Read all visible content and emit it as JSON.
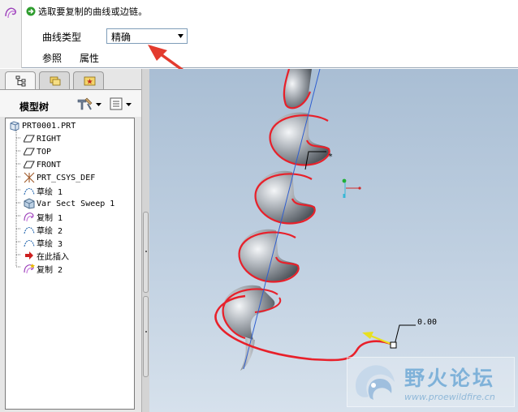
{
  "dashboard": {
    "prompt": "选取要复制的曲线或边链。",
    "curve_type_label": "曲线类型",
    "curve_type_value": "精确",
    "tabs": [
      "参照",
      "属性"
    ]
  },
  "navigator": {
    "tree_title": "模型树",
    "items": [
      {
        "label": "PRT0001.PRT",
        "icon": "part-icon"
      },
      {
        "label": "RIGHT",
        "icon": "datum-plane-icon"
      },
      {
        "label": "TOP",
        "icon": "datum-plane-icon"
      },
      {
        "label": "FRONT",
        "icon": "datum-plane-icon"
      },
      {
        "label": "PRT_CSYS_DEF",
        "icon": "coordinate-system-icon"
      },
      {
        "label": "草绘 1",
        "icon": "sketch-icon"
      },
      {
        "label": "Var Sect Sweep 1",
        "icon": "sweep-icon"
      },
      {
        "label": "复制 1",
        "icon": "copy-curve-icon"
      },
      {
        "label": "草绘 2",
        "icon": "sketch-icon"
      },
      {
        "label": "草绘 3",
        "icon": "sketch-icon"
      },
      {
        "label": "在此插入",
        "icon": "insert-here-arrow-icon"
      },
      {
        "label": "复制 2",
        "icon": "copy-curve-new-icon"
      }
    ]
  },
  "graphics": {
    "dimension_value": "0.00",
    "point_label": "*"
  },
  "watermark": {
    "name": "野火论坛",
    "url": "www.proewildfire.cn"
  },
  "colors": {
    "highlight_red": "#e8202a",
    "annotation_red": "#e33b2e",
    "tree_link": "#000000"
  }
}
